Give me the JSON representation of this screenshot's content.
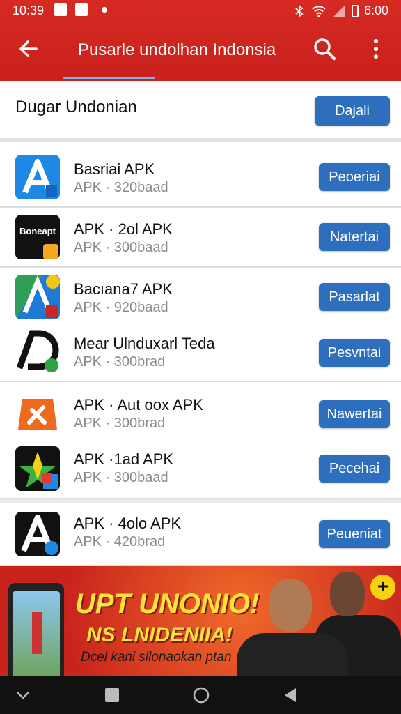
{
  "status_bar": {
    "time": "10:39",
    "clock_right": "6:00"
  },
  "app_bar": {
    "title": "Pusarle undolhan Indonsia"
  },
  "header": {
    "title": "Dugar Undonian",
    "button_label": "Dajali"
  },
  "apps": [
    {
      "name": "Basriai APK",
      "meta": "APK · 320baad",
      "button": "Peoeriai",
      "icon": "blue-a-app-icon"
    },
    {
      "name": "APK · 2ol APK",
      "meta": "APK · 300baad",
      "button": "Natertai",
      "icon": "bonearc-app-icon",
      "icon_text": "Boneapt"
    },
    {
      "name": "Bacıana7 APK",
      "meta": "APK · 920baad",
      "button": "Pasarlat",
      "icon": "green-a-app-icon"
    },
    {
      "name": "Mear Ulnduxarl Teda",
      "meta": "APK · 300brad",
      "button": "Pesvntai",
      "icon": "black-d-app-icon"
    },
    {
      "name": "APK ·  Aut oox APK",
      "meta": "APK · 300brad",
      "button": "Nawertai",
      "icon": "orange-tool-app-icon"
    },
    {
      "name": "APK ·1ad APK",
      "meta": "APK · 300baad",
      "button": "Pecehai",
      "icon": "green-star-app-icon"
    },
    {
      "name": "APK · 4olo APK",
      "meta": "APK · 420brad",
      "button": "Peueniat",
      "icon": "white-a-app-icon"
    }
  ],
  "banner": {
    "line1": "UPT UNONIO!",
    "line2": "NS LNIDENIIA!",
    "line3": "Dcel kani sllonaokan ptan"
  },
  "colors": {
    "app_bar": "#d62a23",
    "button": "#2e6fbd",
    "banner_text": "#ffe23a"
  }
}
